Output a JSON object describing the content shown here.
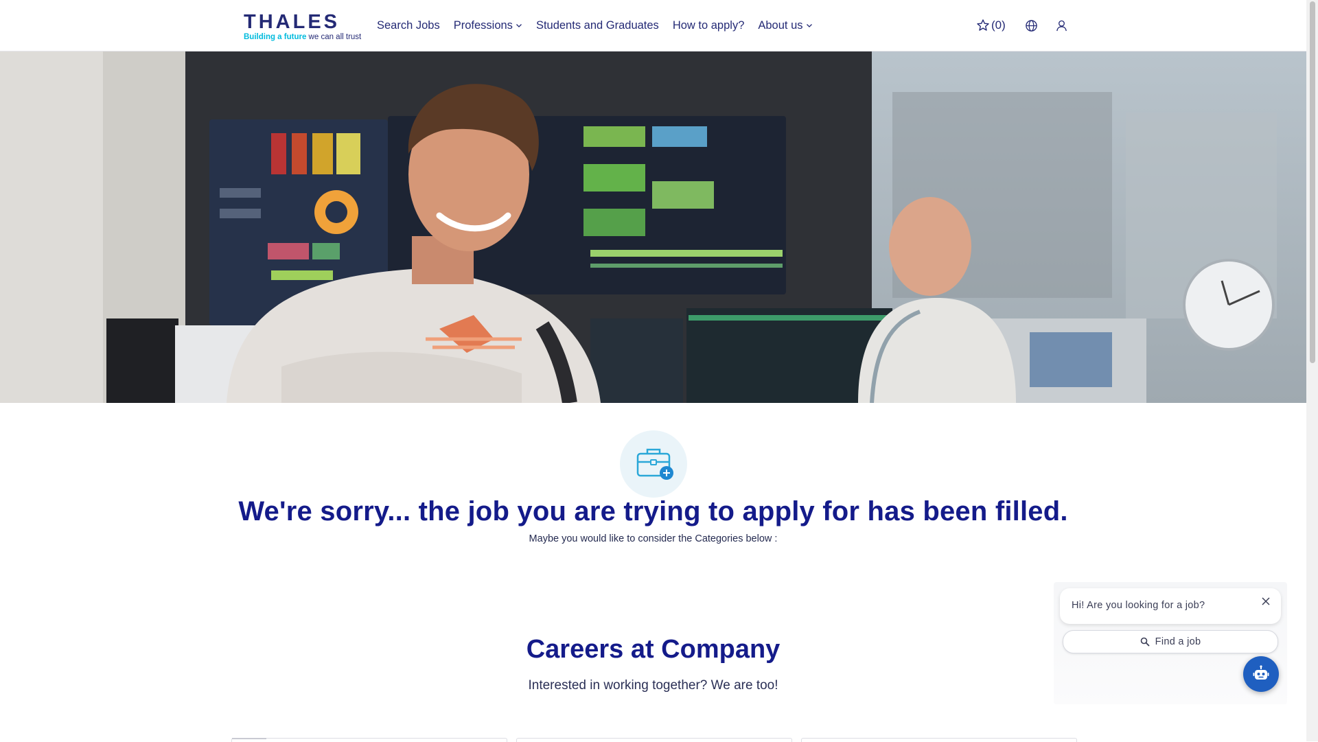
{
  "header": {
    "logo_word": "THALES",
    "logo_tag_highlight": "Building a future",
    "logo_tag_rest": " we can all trust",
    "nav": [
      {
        "label": "Search Jobs"
      },
      {
        "label": "Professions"
      },
      {
        "label": "Students and Graduates"
      },
      {
        "label": "How to apply?"
      },
      {
        "label": "About us"
      }
    ],
    "favorites_count": "(0)"
  },
  "content": {
    "sorry_heading": "We're sorry... the job you are trying to apply for has been filled.",
    "maybe_text": "Maybe you would like to consider the Categories below :",
    "careers_title": "Careers at Company",
    "careers_sub": "Interested in working together? We are too!"
  },
  "chat": {
    "greeting": "Hi! Are you looking for a job?",
    "find_label": "Find a job"
  },
  "colors": {
    "brand_navy": "#242a75",
    "heading_blue": "#141b8a",
    "accent_cyan": "#00bbdd",
    "bot_blue": "#1f5fc0"
  }
}
